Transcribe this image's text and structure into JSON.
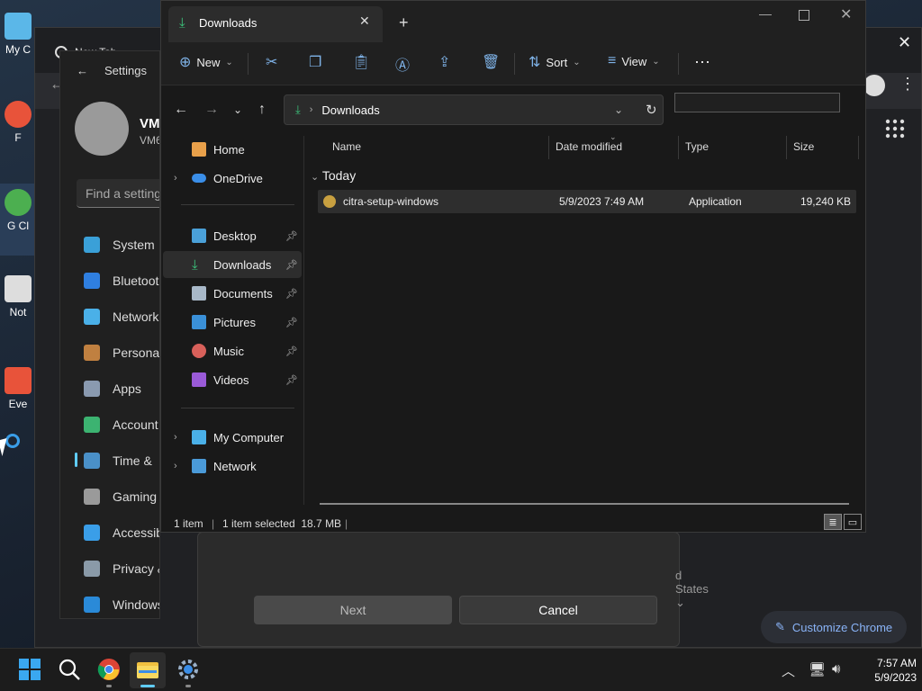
{
  "desktop": {
    "icons": [
      {
        "label": "My C",
        "color": "#5bb7e8"
      },
      {
        "label": "F",
        "color": "#e8533a"
      },
      {
        "label": "G Cl",
        "color": "#4caf50"
      },
      {
        "label": "Not",
        "color": "#dddddd"
      },
      {
        "label": "Eve",
        "color": "#e8533a"
      }
    ]
  },
  "chrome": {
    "tab_title": "New Tab",
    "close_symbol": "✕",
    "customize_label": "Customize Chrome",
    "dialog": {
      "region_text": "d States",
      "next_label": "Next",
      "cancel_label": "Cancel"
    }
  },
  "settings": {
    "title": "Settings",
    "user_name": "VM",
    "user_sub": "VM6",
    "search_placeholder": "Find a setting",
    "nav": [
      {
        "label": "System",
        "icon": "system-icon",
        "color": "#3aa0d8"
      },
      {
        "label": "Bluetoot",
        "icon": "bluetooth-icon",
        "color": "#2f7fe0"
      },
      {
        "label": "Network",
        "icon": "wifi-icon",
        "color": "#4ab0e8"
      },
      {
        "label": "Personal",
        "icon": "brush-icon",
        "color": "#c08040"
      },
      {
        "label": "Apps",
        "icon": "apps-icon",
        "color": "#8a9ab0"
      },
      {
        "label": "Account",
        "icon": "account-icon",
        "color": "#3cb371"
      },
      {
        "label": "Time &",
        "icon": "globe-clock-icon",
        "color": "#4a90c8"
      },
      {
        "label": "Gaming",
        "icon": "gamepad-icon",
        "color": "#9a9a9a"
      },
      {
        "label": "Accessibility",
        "icon": "accessibility-icon",
        "color": "#3a9ee8"
      },
      {
        "label": "Privacy & secu",
        "icon": "shield-icon",
        "color": "#8a9aa8"
      },
      {
        "label": "Windows Upda",
        "icon": "update-icon",
        "color": "#2a8ad8"
      }
    ]
  },
  "explorer": {
    "tab_title": "Downloads",
    "toolbar": {
      "new_label": "New",
      "sort_label": "Sort",
      "view_label": "View"
    },
    "address": {
      "path": "Downloads"
    },
    "nav_pane": {
      "home": "Home",
      "onedrive": "OneDrive",
      "quick_access": [
        "Desktop",
        "Downloads",
        "Documents",
        "Pictures",
        "Music",
        "Videos"
      ],
      "my_computer": "My Computer",
      "network": "Network"
    },
    "columns": {
      "name": "Name",
      "date_modified": "Date modified",
      "type": "Type",
      "size": "Size"
    },
    "group_label": "Today",
    "files": [
      {
        "name": "citra-setup-windows",
        "date_modified": "5/9/2023 7:49 AM",
        "type": "Application",
        "size": "19,240 KB"
      }
    ],
    "status": {
      "item_count": "1 item",
      "selection": "1 item selected  18.7 MB"
    }
  },
  "taskbar": {
    "time": "7:57 AM",
    "date": "5/9/2023"
  }
}
